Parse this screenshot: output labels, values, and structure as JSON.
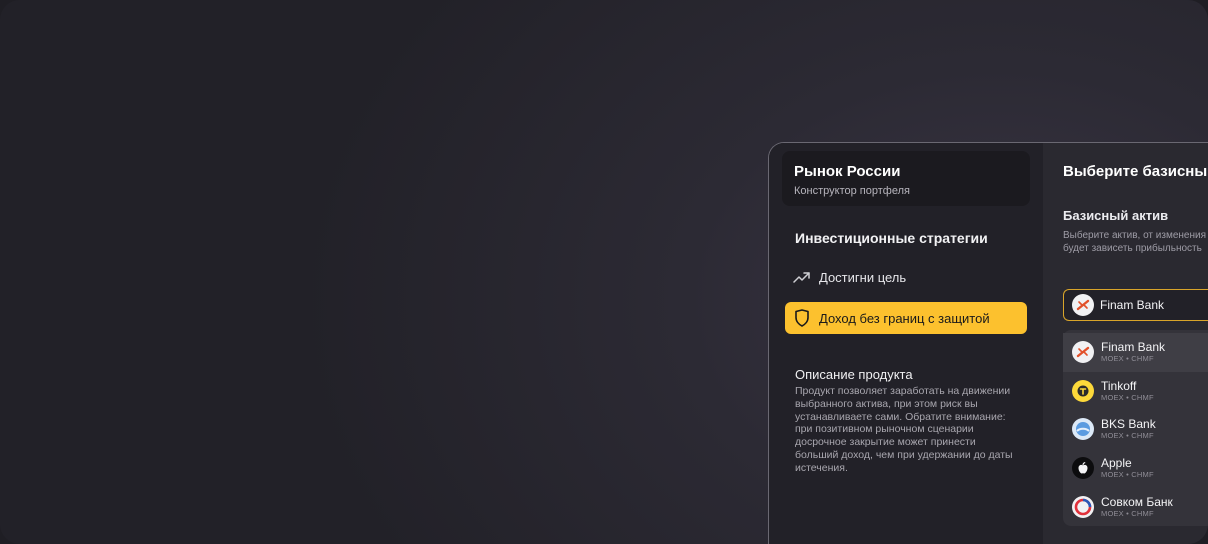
{
  "sidebar": {
    "brand_title": "Рынок России",
    "brand_subtitle": "Конструктор портфеля",
    "strategies_title": "Инвестиционные стратегии",
    "items": [
      {
        "label": "Достигни цель",
        "icon": "trend-up-icon",
        "active": false
      },
      {
        "label": "Доход без границ с защитой",
        "icon": "shield-icon",
        "active": true
      }
    ],
    "description_title": "Описание продукта",
    "description_text": "Продукт позволяет заработать на движении выбранного актива, при этом риск вы устанавливаете сами. Обратите внимание: при позитивном рыночном сценарии досрочное закрытие может принести больший доход, чем при удержании до даты истечения."
  },
  "main": {
    "heading": "Выберите базисный",
    "field_title": "Базисный актив",
    "field_help": "Выберите актив, от изменения\nбудет зависеть прибыльность",
    "selected_value": "Finam Bank",
    "options": [
      {
        "name": "Finam Bank",
        "meta": "MOEX • CHMF",
        "logo": "finam-logo-icon",
        "hover": true
      },
      {
        "name": "Tinkoff",
        "meta": "MOEX • CHMF",
        "logo": "tinkoff-logo-icon",
        "hover": false
      },
      {
        "name": "BKS Bank",
        "meta": "MOEX • CHMF",
        "logo": "bks-logo-icon",
        "hover": false
      },
      {
        "name": "Apple",
        "meta": "MOEX • CHMF",
        "logo": "apple-logo-icon",
        "hover": false
      },
      {
        "name": "Совком Банк",
        "meta": "MOEX • CHMF",
        "logo": "sovcom-logo-icon",
        "hover": false
      }
    ]
  },
  "colors": {
    "accent": "#fcc12e",
    "select_border": "#d9a52a",
    "background": "#222128"
  }
}
